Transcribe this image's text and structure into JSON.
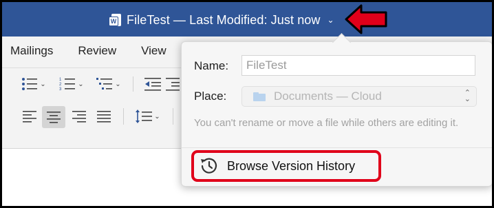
{
  "titlebar": {
    "app_icon": "word-doc-icon",
    "app_badge": "W",
    "title": "FileTest — Last Modified: Just now",
    "chevron": "⌄",
    "background": "#2f5597",
    "annotation_arrow_color": "#e0001a"
  },
  "ribbon": {
    "tabs": [
      {
        "label": "Mailings"
      },
      {
        "label": "Review"
      },
      {
        "label": "View"
      }
    ]
  },
  "popover": {
    "name_label": "Name:",
    "name_value": "FileTest",
    "place_label": "Place:",
    "place_value": "Documents — Cloud",
    "note": "You can't rename or move a file while others are editing it.",
    "browse_label": "Browse Version History",
    "highlight_color": "#e0001a"
  }
}
